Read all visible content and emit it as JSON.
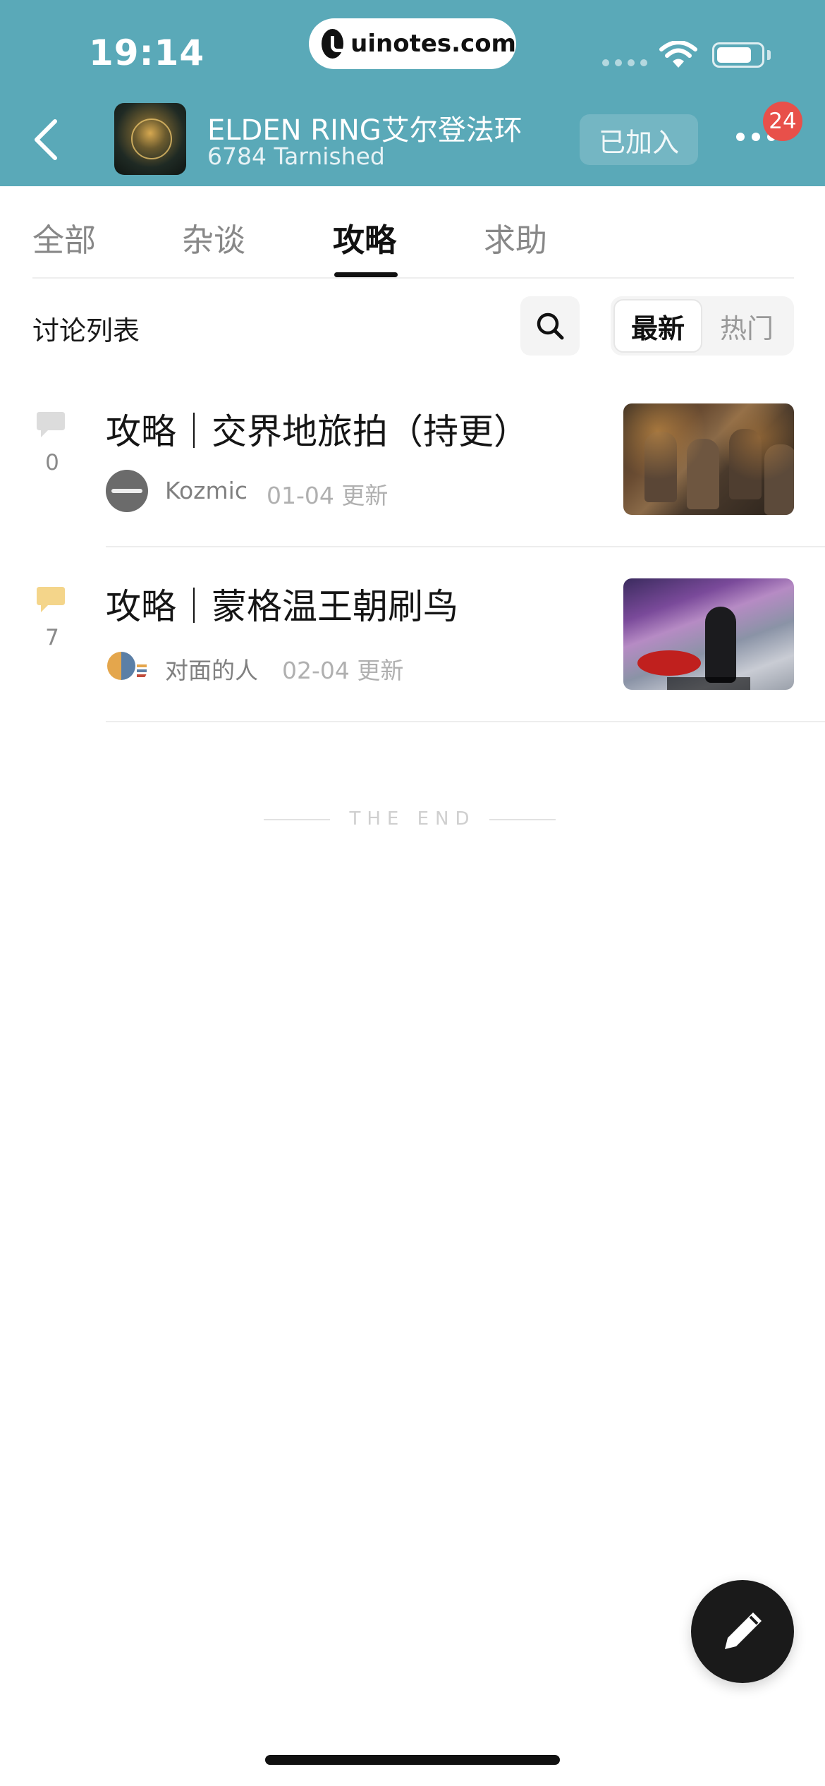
{
  "status_bar": {
    "time": "19:14",
    "url": "uinotes.com"
  },
  "header": {
    "group_name": "ELDEN RING艾尔登法环",
    "member_count": "6784 Tarnished",
    "joined_label": "已加入",
    "notification_count": "24"
  },
  "tabs": [
    {
      "label": "全部",
      "active": false
    },
    {
      "label": "杂谈",
      "active": false
    },
    {
      "label": "攻略",
      "active": true
    },
    {
      "label": "求助",
      "active": false
    }
  ],
  "list": {
    "title": "讨论列表",
    "sort": {
      "newest": "最新",
      "hot": "热门",
      "selected": "最新"
    }
  },
  "posts": [
    {
      "title": "攻略｜交界地旅拍（持更）",
      "comments": "0",
      "author": "Kozmic",
      "updated": "01-04 更新",
      "icon_color": "#dcdcdc"
    },
    {
      "title": "攻略｜蒙格温王朝刷鸟",
      "comments": "7",
      "author": "对面的人",
      "updated": "02-04 更新",
      "icon_color": "#f4d58a"
    }
  ],
  "end_text": "THE END",
  "colors": {
    "header_bg": "#5aa9b8",
    "badge": "#e8504a",
    "fab": "#1a1a1a"
  }
}
